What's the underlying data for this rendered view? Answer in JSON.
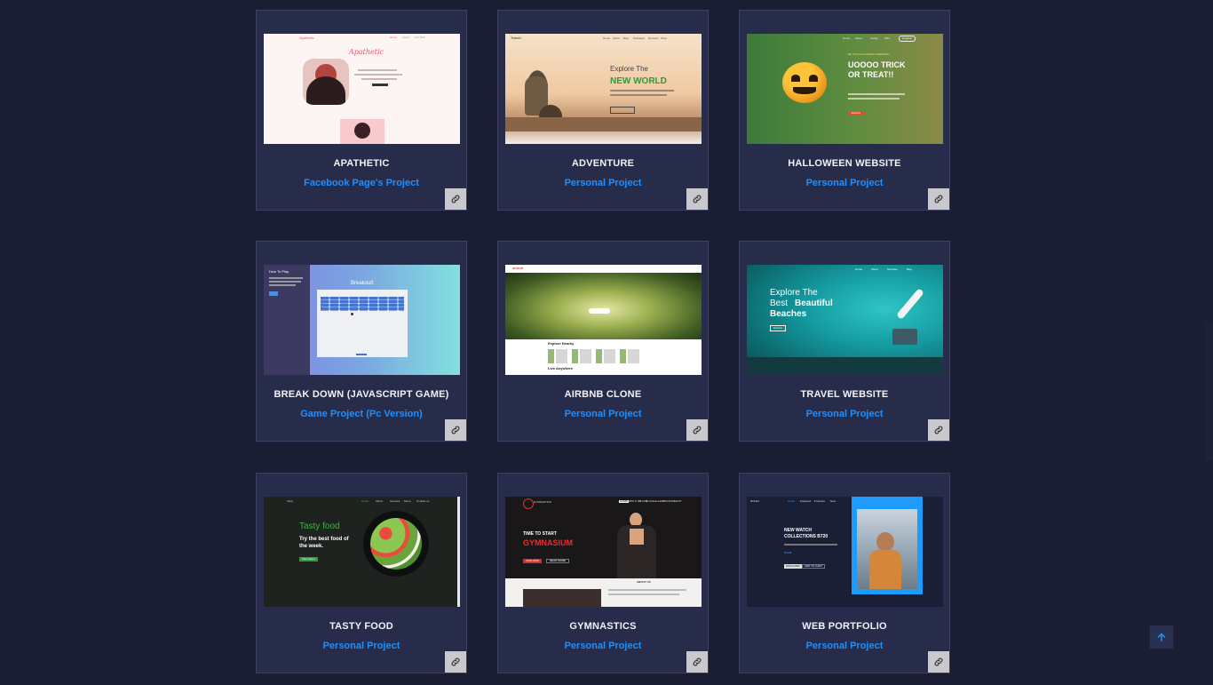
{
  "colors": {
    "background": "#1b1d33",
    "card": "#282c4b",
    "accent": "#1e90ff"
  },
  "link_icon": "link-icon",
  "scroll_top_icon": "arrow-up-icon",
  "projects": [
    {
      "title": "APATHETIC",
      "subtitle": "Facebook Page's Project",
      "preview": {
        "brand": "Apathetic",
        "nav": [
          "Home",
          "About",
          "Get Start"
        ],
        "heading": "Apathetic"
      }
    },
    {
      "title": "ADVENTURE",
      "subtitle": "Personal Project",
      "preview": {
        "brand": "Travel.",
        "nav": [
          "Home",
          "About",
          "Blog",
          "Packages",
          "Reviews",
          "Shop"
        ],
        "line1": "Explore The",
        "line2": "NEW WORLD"
      }
    },
    {
      "title": "HALLOWEEN WEBSITE",
      "subtitle": "Personal Project",
      "preview": {
        "nav": [
          "Home",
          "About",
          "Candy",
          "Wiki"
        ],
        "action": "Register",
        "tag": "BE TOP HALLOWEEN WEEKEND",
        "heading": "UOOOO TRICK OR TREAT!!",
        "button": "Explore"
      }
    },
    {
      "title": "BREAK DOWN (JAVASCRIPT GAME)",
      "subtitle": "Game Project (Pc Version)",
      "preview": {
        "side_title": "How To Play",
        "heading": "Breakout!"
      }
    },
    {
      "title": "AIRBNB CLONE",
      "subtitle": "Personal Project",
      "preview": {
        "brand": "airbnb",
        "section1": "Explore Nearby",
        "section2": "Live Anywhere"
      }
    },
    {
      "title": "TRAVEL WEBSITE",
      "subtitle": "Personal Project",
      "preview": {
        "nav": [
          "Home",
          "About",
          "Services",
          "Blog"
        ],
        "line1": "Explore The",
        "line2": "Best",
        "line2b": "Beautiful",
        "line3": "Beaches",
        "button": "Explore"
      }
    },
    {
      "title": "TASTY FOOD",
      "subtitle": "Personal Project",
      "preview": {
        "brand": "Tasty",
        "nav": [
          "Home",
          "About",
          "Services",
          "Menu",
          "Contact us"
        ],
        "heading": "Tasty food",
        "text": "Try the best food of the week.",
        "button": "View Menu"
      }
    },
    {
      "title": "GYMNASTICS",
      "subtitle": "Personal Project",
      "preview": {
        "brand": "GYMNASTICS",
        "nav": [
          "HOME",
          "ABOUT US",
          "CLASS",
          "BLOG",
          "GALLERY",
          "TRAINING",
          "SHOP"
        ],
        "line1": "TIME TO START",
        "line2": "GYMNASIUM",
        "button1": "JOIN NOW",
        "button2": "READ MORE",
        "section": "ABOUT US"
      }
    },
    {
      "title": "WEB PORTFOLIO",
      "subtitle": "Personal Project",
      "preview": {
        "brand": "ROLEX",
        "nav": [
          "Home",
          "Featured",
          "Products",
          "New"
        ],
        "heading": "NEW WATCH COLLECTIONS B720",
        "price": "$1245",
        "button1": "DISCOVER",
        "button2": "ADD TO CART"
      }
    }
  ]
}
